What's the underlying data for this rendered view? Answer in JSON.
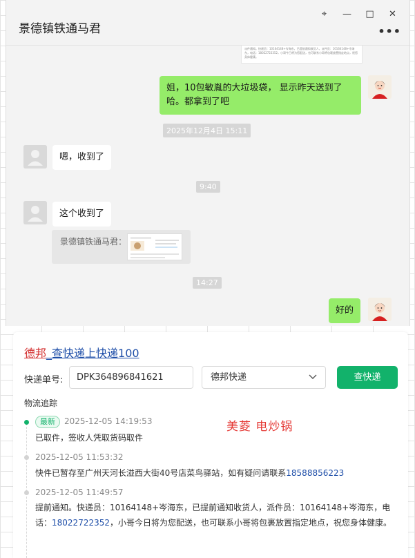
{
  "window": {
    "title": "景德镇铁通马君",
    "controls": {
      "pin": "⌖",
      "minimize": "—",
      "maximize": "□",
      "close": "✕"
    },
    "more": "•••"
  },
  "top_snippet_text": "派件通知。快递员：10164148+岑海东，已提前通知收货人，派件员：10164148+岑海东，电话：18022722352，小哥今日将为您配送，也可联系小哥将包裹放置指定地点，祝您身体健康。",
  "messages": [
    {
      "side": "me",
      "text": "姐，10包敏胤的大垃圾袋， 显示昨天送到了哈。都拿到了吧"
    },
    {
      "type": "timestamp",
      "text": "2025年12月4日 15:11"
    },
    {
      "side": "them",
      "text": "嗯，收到了"
    },
    {
      "type": "timestamp",
      "text": "9:40"
    },
    {
      "side": "them",
      "text": "这个收到了"
    },
    {
      "type": "quote",
      "text": "景德镇铁通马君："
    },
    {
      "type": "timestamp",
      "text": "14:27"
    },
    {
      "side": "me",
      "text": "好的"
    }
  ],
  "tracking": {
    "brand": "德邦",
    "link_text": "_查快递上快递100",
    "label": "快递单号:",
    "number": "DPK364896841621",
    "carrier": "德邦快递",
    "query_button": "查快递",
    "section_title": "物流追踪",
    "annotation": "美菱 电炒锅",
    "events": [
      {
        "badge": "最新",
        "time": "2025-12-05 14:19:53",
        "desc": "已取件，签收人凭取货码取件"
      },
      {
        "time": "2025-12-05 11:53:32",
        "desc_prefix": "快件已暂存至广州天河长湴西大街40号店菜鸟驿站，如有疑问请联系",
        "phone": "18588856223",
        "desc_suffix": ""
      },
      {
        "time": "2025-12-05 11:49:57",
        "desc_prefix": "提前通知。快递员：10164148+岑海东，已提前通知收货人，派件员：10164148+岑海东，电话：",
        "phone": "18022722352",
        "desc_suffix": "，小哥今日将为您配送，也可联系小哥将包裹放置指定地点，祝您身体健康。"
      }
    ]
  },
  "colors": {
    "me_bubble": "#95ec69",
    "them_bubble": "#ffffff",
    "accent_green": "#12b26b",
    "link_blue": "#1e4ea8",
    "brand_red": "#d32f2f",
    "annotation_red": "#e53935"
  }
}
